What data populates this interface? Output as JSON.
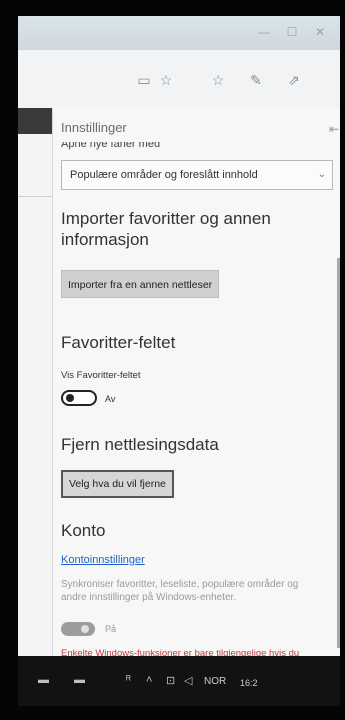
{
  "window": {
    "minimize_glyph": "—",
    "maximize_glyph": "☐",
    "close_glyph": "✕"
  },
  "toolbar": {
    "icons": [
      "reading-view-icon",
      "favorite-star-icon",
      "favorites-hub-icon",
      "pen-icon",
      "share-icon"
    ]
  },
  "settings": {
    "title": "Innstillinger",
    "cut_label": "Åpne nye faner med",
    "new_tab_dropdown": {
      "selected": "Populære områder og foreslått innhold"
    },
    "import_heading": "Importer favoritter og annen informasjon",
    "import_button": "Importer fra en annen nettleser",
    "favorites_bar_heading": "Favoritter-feltet",
    "show_favorites_bar_label": "Vis Favoritter-feltet",
    "favorites_bar_toggle_state": "Av",
    "clear_data_heading": "Fjern nettlesingsdata",
    "clear_data_button": "Velg hva du vil fjerne",
    "account_heading": "Konto",
    "account_link": "Kontoinnstillinger",
    "sync_text": "Synkroniser favoritter, leseliste, populære områder og andre innstillinger på Windows-enheter.",
    "sync_toggle_state": "På",
    "warning_text": "Enkelte Windows-funksjoner er bare tilgjengelige hvis du"
  },
  "taskbar": {
    "lang": "NOR",
    "clock": "16:2"
  }
}
